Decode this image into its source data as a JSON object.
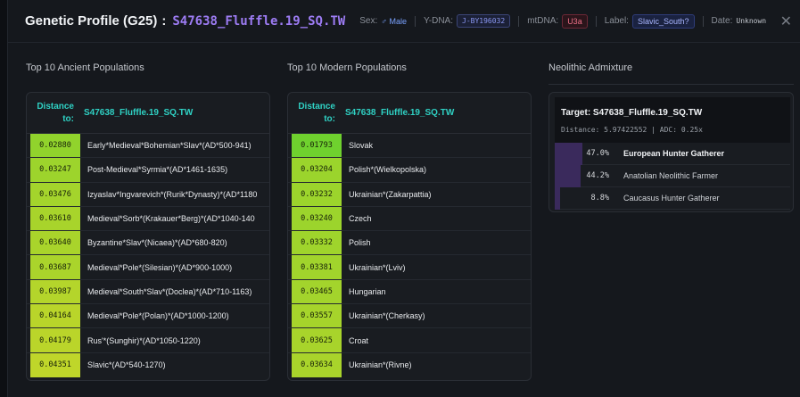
{
  "header": {
    "title": "Genetic Profile (G25)",
    "separator": ":",
    "sample": "S47638_Fluffle.19_SQ.TW",
    "sex_label": "Sex:",
    "sex_value": "♂ Male",
    "ydna_label": "Y-DNA:",
    "ydna_value": "J-BY196032",
    "mtdna_label": "mtDNA:",
    "mtdna_value": "U3a",
    "label_label": "Label:",
    "label_value": "Slavic_South?",
    "date_label": "Date:",
    "date_value": "Unknown",
    "close_icon": "✕"
  },
  "ancient": {
    "title": "Top 10 Ancient Populations",
    "dist_header_1": "Distance",
    "dist_header_2": "to:",
    "sample_header": "S47638_Fluffle.19_SQ.TW",
    "rows": [
      {
        "distance": "0.02880",
        "population": "Early*Medieval*Bohemian*Slav*(AD*500-941)"
      },
      {
        "distance": "0.03247",
        "population": "Post-Medieval*Syrmia*(AD*1461-1635)"
      },
      {
        "distance": "0.03476",
        "population": "Izyaslav*Ingvarevich*(Rurik*Dynasty)*(AD*1180"
      },
      {
        "distance": "0.03610",
        "population": "Medieval*Sorb*(Krakauer*Berg)*(AD*1040-140"
      },
      {
        "distance": "0.03640",
        "population": "Byzantine*Slav*(Nicaea)*(AD*680-820)"
      },
      {
        "distance": "0.03687",
        "population": "Medieval*Pole*(Silesian)*(AD*900-1000)"
      },
      {
        "distance": "0.03987",
        "population": "Medieval*South*Slav*(Doclea)*(AD*710-1163)"
      },
      {
        "distance": "0.04164",
        "population": "Medieval*Pole*(Polan)*(AD*1000-1200)"
      },
      {
        "distance": "0.04179",
        "population": "Rus'*(Sunghir)*(AD*1050-1220)"
      },
      {
        "distance": "0.04351",
        "population": "Slavic*(AD*540-1270)"
      }
    ]
  },
  "modern": {
    "title": "Top 10 Modern Populations",
    "dist_header_1": "Distance",
    "dist_header_2": "to:",
    "sample_header": "S47638_Fluffle.19_SQ.TW",
    "rows": [
      {
        "distance": "0.01793",
        "population": "Slovak"
      },
      {
        "distance": "0.03204",
        "population": "Polish*(Wielkopolska)"
      },
      {
        "distance": "0.03232",
        "population": "Ukrainian*(Zakarpattia)"
      },
      {
        "distance": "0.03240",
        "population": "Czech"
      },
      {
        "distance": "0.03332",
        "population": "Polish"
      },
      {
        "distance": "0.03381",
        "population": "Ukrainian*(Lviv)"
      },
      {
        "distance": "0.03465",
        "population": "Hungarian"
      },
      {
        "distance": "0.03557",
        "population": "Ukrainian*(Cherkasy)"
      },
      {
        "distance": "0.03625",
        "population": "Croat"
      },
      {
        "distance": "0.03634",
        "population": "Ukrainian*(Rivne)"
      }
    ]
  },
  "neolithic": {
    "title": "Neolithic Admixture",
    "target": "Target: S47638_Fluffle.19_SQ.TW",
    "stats": "Distance: 5.97422552  |  ADC: 0.25x",
    "components": [
      {
        "pct_label": "47.0%",
        "fraction": 0.47,
        "name": "European Hunter Gatherer"
      },
      {
        "pct_label": "44.2%",
        "fraction": 0.442,
        "name": "Anatolian Neolithic Farmer"
      },
      {
        "pct_label": "8.8%",
        "fraction": 0.088,
        "name": "Caucasus Hunter Gatherer"
      }
    ]
  },
  "colors": {
    "accent_purple": "#9d7cf4",
    "accent_teal": "#2fd1c4",
    "best_green": "#7fd62a",
    "bar_purple": "#3a2a5c"
  }
}
